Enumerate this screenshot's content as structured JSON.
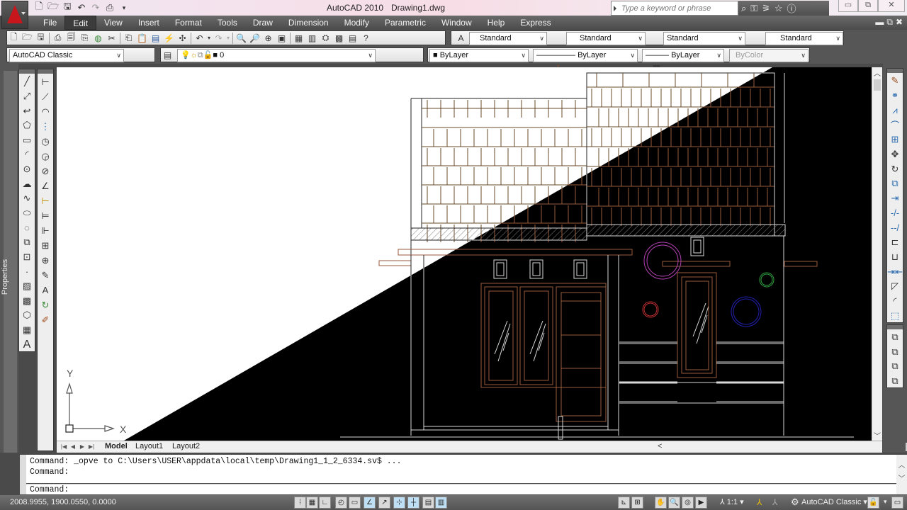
{
  "window": {
    "app_title": "AutoCAD 2010",
    "document_name": "Drawing1.dwg",
    "search_placeholder": "Type a keyword or phrase",
    "minimize_icon": "minimize-icon",
    "restore_icon": "restore-icon",
    "close_icon": "close-icon"
  },
  "quick_access": [
    "new-icon",
    "open-icon",
    "save-icon",
    "undo-icon",
    "redo-icon",
    "plot-icon",
    "customize-dropdown-icon"
  ],
  "search_tools": [
    "binoculars-icon",
    "key-icon",
    "satellite-icon",
    "star-icon",
    "help-icon"
  ],
  "menubar": {
    "items": [
      "File",
      "Edit",
      "View",
      "Insert",
      "Format",
      "Tools",
      "Draw",
      "Dimension",
      "Modify",
      "Parametric",
      "Window",
      "Help",
      "Express"
    ],
    "active": "Edit"
  },
  "standard_toolbar": {
    "icons": [
      "qnew-icon",
      "open-icon",
      "save-icon",
      "plot-icon",
      "plot-preview-icon",
      "publish-icon",
      "3d-dwf-icon",
      "cut-icon",
      "copy-icon",
      "paste-icon",
      "match-properties-icon",
      "block-editor-icon",
      "undo-icon",
      "redo-icon",
      "pan-icon",
      "zoom-realtime-icon",
      "zoom-window-icon",
      "zoom-previous-icon",
      "properties-icon",
      "design-center-icon",
      "tool-palettes-icon",
      "sheet-set-icon",
      "markup-icon",
      "calculator-icon",
      "help-icon"
    ]
  },
  "styles_toolbar": {
    "text_style": "Standard",
    "dim_style": "Standard",
    "table_style": "Standard",
    "multileader_style": "Standard"
  },
  "workspace_toolbar": {
    "workspace": "AutoCAD Classic"
  },
  "layers_toolbar": {
    "current_layer": "0"
  },
  "properties_toolbar": {
    "color": "ByLayer",
    "linetype": "ByLayer",
    "lineweight": "ByLayer",
    "plot_style": "ByColor"
  },
  "palette": {
    "properties_label": "Properties"
  },
  "draw_toolbar": [
    "line-icon",
    "construction-line-icon",
    "polyline-icon",
    "polygon-icon",
    "rectangle-icon",
    "arc-icon",
    "circle-icon",
    "revision-cloud-icon",
    "spline-icon",
    "ellipse-icon",
    "ellipse-arc-icon",
    "insert-block-icon",
    "make-block-icon",
    "point-icon",
    "hatch-icon",
    "gradient-icon",
    "region-icon",
    "table-icon",
    "multiline-text-icon"
  ],
  "dimension_toolbar": [
    "linear-dim-icon",
    "aligned-dim-icon",
    "arc-length-icon",
    "ordinate-icon",
    "radius-icon",
    "jogged-icon",
    "diameter-icon",
    "angular-icon",
    "quick-dim-icon",
    "baseline-icon",
    "continue-icon",
    "tolerance-icon",
    "center-mark-icon",
    "dim-edit-icon",
    "dim-text-edit-icon",
    "dim-update-icon",
    "dim-style-icon"
  ],
  "modify_toolbar": [
    "erase-icon",
    "copy-icon",
    "mirror-icon",
    "offset-icon",
    "array-icon",
    "move-icon",
    "rotate-icon",
    "scale-icon",
    "stretch-icon",
    "trim-icon",
    "extend-icon",
    "break-at-point-icon",
    "break-icon",
    "join-icon",
    "chamfer-icon",
    "fillet-icon",
    "explode-icon"
  ],
  "draworder_toolbar": [
    "bring-to-front-icon",
    "send-to-back-icon",
    "bring-above-icon",
    "send-under-icon"
  ],
  "ucs": {
    "x_label": "X",
    "y_label": "Y"
  },
  "layout_tabs": {
    "tabs": [
      "Model",
      "Layout1",
      "Layout2"
    ],
    "active": "Model"
  },
  "command": {
    "history": [
      "Command:  _opve to C:\\Users\\USER\\appdata\\local\\temp\\Drawing1_1_2_6334.sv$ ...",
      "Command:"
    ],
    "prompt": "Command:"
  },
  "status": {
    "coordinates": "2008.9955, 1900.0550, 0.0000",
    "toggles": [
      {
        "name": "infer-constraints",
        "on": false
      },
      {
        "name": "snap",
        "on": false
      },
      {
        "name": "grid",
        "on": false
      },
      {
        "name": "ortho",
        "on": false
      },
      {
        "name": "polar",
        "on": false
      },
      {
        "name": "osnap",
        "on": true
      },
      {
        "name": "3d-osnap",
        "on": false
      },
      {
        "name": "otrack",
        "on": true
      },
      {
        "name": "ducs",
        "on": true
      },
      {
        "name": "dyn",
        "on": false
      },
      {
        "name": "lwt",
        "on": true
      }
    ],
    "annotation_scale": "1:1",
    "workspace": "AutoCAD Classic"
  },
  "drawing": {
    "colors": {
      "model_space_bg": "#000000",
      "selection_white": "#ffffff",
      "line_white": "#d8d8d8",
      "line_brown": "#9a5a3c",
      "circle_magenta": "#b040b0",
      "circle_red": "#c03030",
      "circle_green": "#30a040",
      "circle_blue": "#2020b0"
    }
  }
}
